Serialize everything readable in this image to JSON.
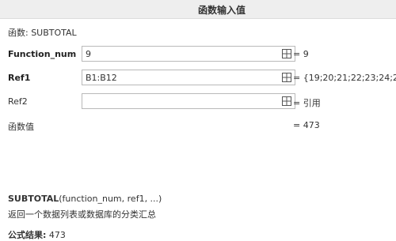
{
  "dialog": {
    "title": "函数输入值"
  },
  "function_line": "函数: SUBTOTAL",
  "args": [
    {
      "label": "Function_num",
      "value": "9",
      "result": "= 9",
      "bold": true
    },
    {
      "label": "Ref1",
      "value": "B1:B12",
      "result": "= {19;20;21;22;23;24;25;",
      "bold": true
    },
    {
      "label": "Ref2",
      "value": "",
      "result": "= 引用",
      "bold": false
    }
  ],
  "function_value": {
    "label": "函数值",
    "result": "= 473"
  },
  "syntax": {
    "name": "SUBTOTAL",
    "params": "(function_num, ref1, ...)"
  },
  "description": "返回一个数据列表或数据库的分类汇总",
  "formula_result": {
    "label": "公式结果:",
    "value": "473"
  },
  "icons": {
    "range_select": "range-select-icon"
  }
}
